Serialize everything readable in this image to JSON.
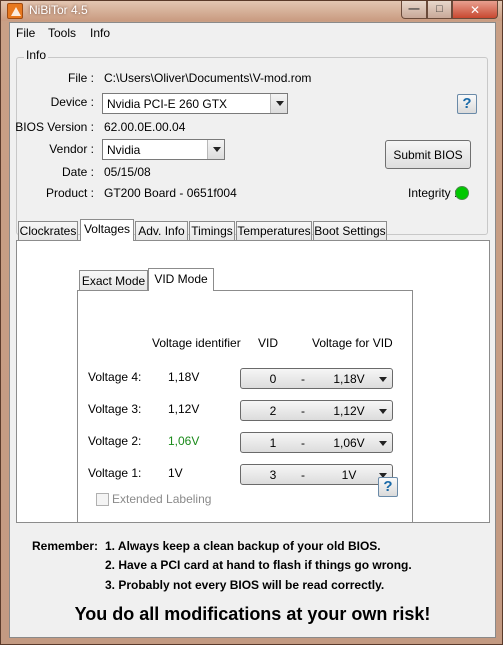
{
  "window": {
    "title": "NiBiTor 4.5"
  },
  "menu": [
    "File",
    "Tools",
    "Info"
  ],
  "info": {
    "legend": "Info",
    "file_label": "File :",
    "file_value": "C:\\Users\\Oliver\\Documents\\V-mod.rom",
    "device_label": "Device :",
    "device_value": "Nvidia PCI-E 260 GTX",
    "bios_label": "BIOS Version :",
    "bios_value": "62.00.0E.00.04",
    "vendor_label": "Vendor :",
    "vendor_value": "Nvidia",
    "date_label": "Date :",
    "date_value": "05/15/08",
    "product_label": "Product :",
    "product_value": "GT200 Board - 0651f004",
    "submit_label": "Submit BIOS",
    "integrity_label": "Integrity :",
    "integrity_color": "#00c800"
  },
  "tabs": [
    "Clockrates",
    "Voltages",
    "Adv. Info",
    "Timings",
    "Temperatures",
    "Boot Settings"
  ],
  "active_tab": "Voltages",
  "subtabs": [
    "Exact Mode",
    "VID Mode"
  ],
  "active_subtab": "VID Mode",
  "vid_mode": {
    "headers": {
      "identifier": "Voltage identifier",
      "vid": "VID",
      "voltage_for_vid": "Voltage for VID"
    },
    "rows": [
      {
        "label": "Voltage 4:",
        "identifier": "1,18V",
        "vid": "0",
        "voltage": "1,18V",
        "identifier_color": "#000000"
      },
      {
        "label": "Voltage 3:",
        "identifier": "1,12V",
        "vid": "2",
        "voltage": "1,12V",
        "identifier_color": "#000000"
      },
      {
        "label": "Voltage 2:",
        "identifier": "1,06V",
        "vid": "1",
        "voltage": "1,06V",
        "identifier_color": "#1a8a1a"
      },
      {
        "label": "Voltage 1:",
        "identifier": "1V",
        "vid": "3",
        "voltage": "1V",
        "identifier_color": "#000000"
      }
    ],
    "separator": "-",
    "extended_labeling": "Extended Labeling"
  },
  "help_glyph": "?",
  "remember": {
    "title": "Remember:",
    "lines": [
      "1. Always keep a clean backup of your old BIOS.",
      "2. Have a PCI card at hand to flash if things go wrong.",
      "3. Probably not every BIOS will be read correctly."
    ]
  },
  "warning": "You do all modifications at your own risk!"
}
